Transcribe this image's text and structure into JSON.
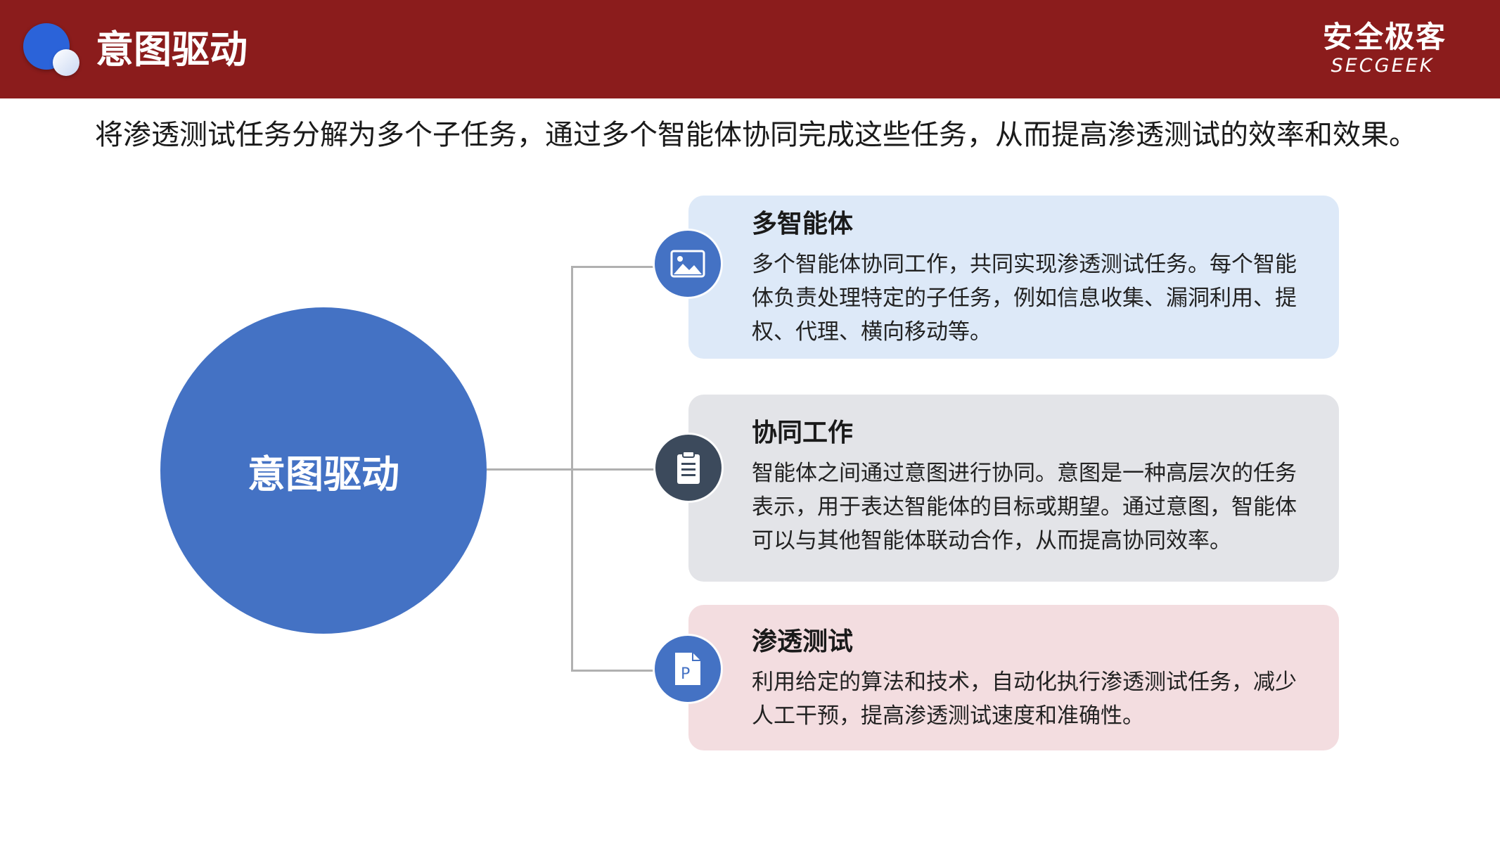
{
  "header": {
    "title": "意图驱动",
    "logo_cn": "安全极客",
    "logo_en": "SECGEEK",
    "bar_color": "#8b1c1c"
  },
  "subtitle": "将渗透测试任务分解为多个子任务，通过多个智能体协同完成这些任务，从而提高渗透测试的效率和效果。",
  "center": {
    "label": "意图驱动",
    "color": "#4472c4"
  },
  "cards": [
    {
      "title": "多智能体",
      "description": "多个智能体协同工作，共同实现渗透测试任务。每个智能体负责处理特定的子任务，例如信息收集、漏洞利用、提权、代理、横向移动等。",
      "icon": "image-icon",
      "background": "#dde9f8"
    },
    {
      "title": "协同工作",
      "description": "智能体之间通过意图进行协同。意图是一种高层次的任务表示，用于表达智能体的目标或期望。通过意图，智能体可以与其他智能体联动合作，从而提高协同效率。",
      "icon": "clipboard-icon",
      "background": "#e3e4e8"
    },
    {
      "title": "渗透测试",
      "description": "利用给定的算法和技术，自动化执行渗透测试任务，减少人工干预，提高渗透测试速度和准确性。",
      "icon": "document-p-icon",
      "background": "#f3dde0"
    }
  ]
}
